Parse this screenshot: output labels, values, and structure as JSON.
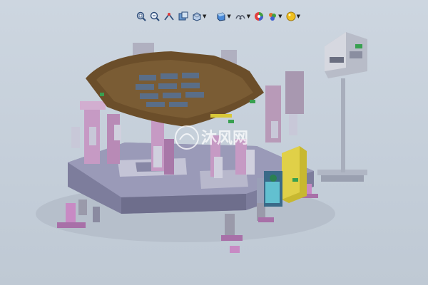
{
  "toolbar": {
    "items": [
      {
        "name": "zoom-to-fit-icon"
      },
      {
        "name": "zoom-to-area-icon"
      },
      {
        "name": "previous-view-icon"
      },
      {
        "name": "section-view-icon"
      },
      {
        "name": "view-orientation-icon",
        "has_dropdown": true
      },
      {
        "name": "display-style-icon",
        "has_dropdown": true
      },
      {
        "name": "hide-show-items-icon",
        "has_dropdown": true
      },
      {
        "name": "edit-appearance-icon"
      },
      {
        "name": "apply-scene-icon",
        "has_dropdown": true
      },
      {
        "name": "view-settings-icon",
        "has_dropdown": true
      }
    ]
  },
  "watermark": {
    "text": "沐风网"
  },
  "colors": {
    "background": "#c8d1dc",
    "base_plate": "#8a8aa8",
    "fixture_pink": "#c8a0c4",
    "fixture_purple": "#a070b0",
    "carpet_brown": "#6b4e2a",
    "yellow_box": "#d8c838",
    "cylinder_cyan": "#80c8d8",
    "stand_gray": "#9aa0b0"
  }
}
